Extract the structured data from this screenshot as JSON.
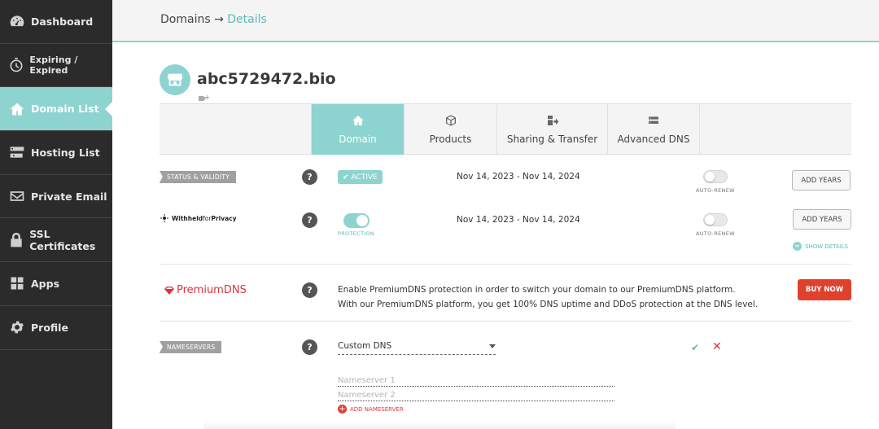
{
  "sidebar": {
    "items": [
      {
        "label": "Dashboard",
        "icon": "speedometer-icon"
      },
      {
        "label": "Expiring / Expired",
        "icon": "stopwatch-icon"
      },
      {
        "label": "Domain List",
        "icon": "home-icon"
      },
      {
        "label": "Hosting List",
        "icon": "server-icon"
      },
      {
        "label": "Private Email",
        "icon": "envelope-icon"
      },
      {
        "label": "SSL Certificates",
        "icon": "lock-icon"
      },
      {
        "label": "Apps",
        "icon": "apps-grid-icon"
      },
      {
        "label": "Profile",
        "icon": "gear-icon"
      }
    ],
    "active_index": 2
  },
  "header": {
    "breadcrumb_root": "Domains",
    "breadcrumb_sep": "→",
    "breadcrumb_current": "Details"
  },
  "domain": {
    "name": "abc5729472.bio",
    "icon": "storefront-icon"
  },
  "tabs": [
    {
      "label": "Domain",
      "icon": "home-icon",
      "active": true
    },
    {
      "label": "Products",
      "icon": "box-icon",
      "active": false
    },
    {
      "label": "Sharing & Transfer",
      "icon": "transfer-icon",
      "active": false
    },
    {
      "label": "Advanced DNS",
      "icon": "dns-server-icon",
      "active": false
    }
  ],
  "status": {
    "section_label": "STATUS & VALIDITY",
    "badge": "ACTIVE",
    "date_range": "Nov 14, 2023 - Nov 14, 2024",
    "autorenew_label": "AUTO-RENEW",
    "autorenew_on": false,
    "button": "ADD YEARS"
  },
  "privacy": {
    "logo_text_1": "Withheld",
    "logo_text_2": "for",
    "logo_text_3": "Privacy",
    "protection_label": "PROTECTION",
    "protection_on": true,
    "date_range": "Nov 14, 2023 - Nov 14, 2024",
    "autorenew_label": "AUTO-RENEW",
    "autorenew_on": false,
    "button": "ADD YEARS",
    "show_details": "SHOW DETAILS"
  },
  "premium_dns": {
    "logo": "PremiumDNS",
    "line1": "Enable PremiumDNS protection in order to switch your domain to our PremiumDNS platform.",
    "line2": "With our PremiumDNS platform, you get 100% DNS uptime and DDoS protection at the DNS level.",
    "button": "BUY NOW"
  },
  "nameservers": {
    "section_label": "NAMESERVERS",
    "selected": "Custom DNS",
    "ns1_placeholder": "Nameserver 1",
    "ns2_placeholder": "Nameserver 2",
    "add_label": "ADD NAMESERVER"
  },
  "help_symbol": "?",
  "colors": {
    "sidebar_bg": "#2b2b2b",
    "accent_teal": "#8dd3d0",
    "accent_red": "#e0412d"
  }
}
